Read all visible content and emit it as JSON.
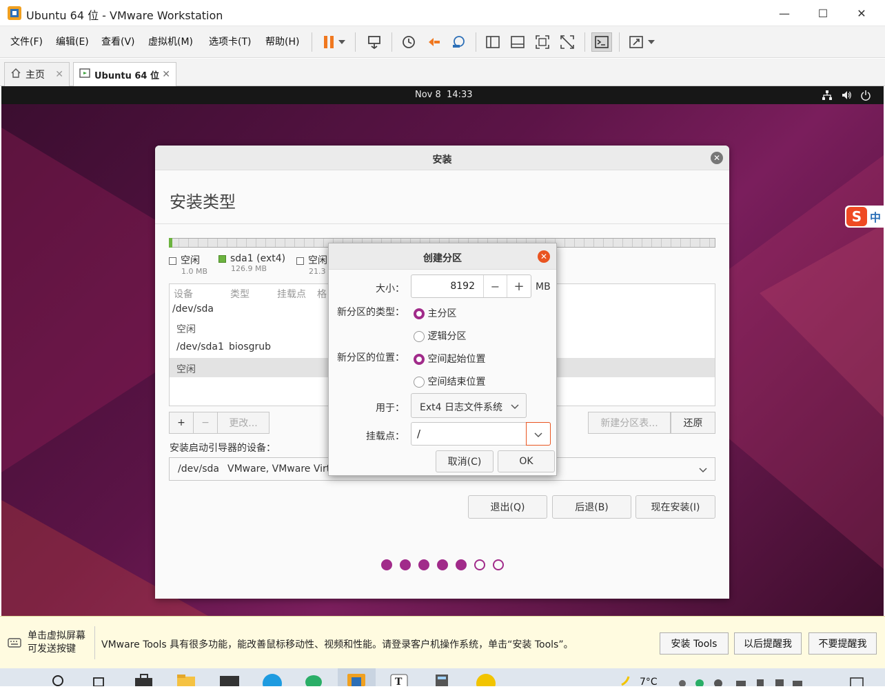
{
  "window": {
    "title": "Ubuntu 64 位 - VMware Workstation",
    "minimize": "—",
    "maximize": "☐",
    "close": "✕"
  },
  "menu": {
    "items": [
      "文件(F)",
      "编辑(E)",
      "查看(V)",
      "虚拟机(M)",
      "选项卡(T)",
      "帮助(H)"
    ]
  },
  "tabs": [
    {
      "label": "主页",
      "icon": "home-icon"
    },
    {
      "label": "Ubuntu 64 位",
      "icon": "vm-icon"
    }
  ],
  "ubuntu_topbar": {
    "date": "Nov 8",
    "time": "14:33"
  },
  "installer": {
    "window_title": "安装",
    "heading": "安装类型",
    "legend": [
      {
        "name": "空闲",
        "size": "1.0 MB",
        "color": "#ffffff"
      },
      {
        "name": "sda1 (ext4)",
        "size": "126.9 MB",
        "color": "#6cb33f"
      },
      {
        "name": "空闲",
        "size": "21.3",
        "color": "#ffffff"
      }
    ],
    "table_headers": [
      "设备",
      "类型",
      "挂载点",
      "格"
    ],
    "rows": [
      {
        "device": "/dev/sda",
        "type": ""
      },
      {
        "device": "空闲",
        "type": ""
      },
      {
        "device": "/dev/sda1",
        "type": "biosgrub"
      },
      {
        "device": "空闲",
        "type": ""
      }
    ],
    "add_btn": "+",
    "remove_btn": "−",
    "change_btn": "更改...",
    "new_table_btn": "新建分区表...",
    "revert_btn": "还原",
    "boot_label": "安装启动引导器的设备：",
    "boot_device": "/dev/sda",
    "boot_desc": "VMware, VMware Virt",
    "quit_btn": "退出(Q)",
    "back_btn": "后退(B)",
    "install_btn": "现在安装(I)",
    "progress_total": 7,
    "progress_done": 5
  },
  "dialog": {
    "title": "创建分区",
    "size_label": "大小：",
    "size_value": "8192",
    "size_unit": "MB",
    "minus": "−",
    "plus": "+",
    "type_label": "新分区的类型：",
    "type_primary": "主分区",
    "type_logical": "逻辑分区",
    "location_label": "新分区的位置：",
    "loc_start": "空间起始位置",
    "loc_end": "空间结束位置",
    "use_label": "用于：",
    "use_value": "Ext4 日志文件系统",
    "mount_label": "挂载点：",
    "mount_value": "/",
    "cancel": "取消(C)",
    "ok": "OK"
  },
  "notice": {
    "hint_line1": "单击虚拟屏幕",
    "hint_line2": "可发送按键",
    "message": "VMware Tools 具有很多功能，能改善鼠标移动性、视频和性能。请登录客户机操作系统，单击“安装 Tools”。",
    "install_tools": "安装 Tools",
    "remind_later": "以后提醒我",
    "never_remind": "不要提醒我"
  },
  "taskbar": {
    "temperature": "7°C"
  },
  "ime": {
    "label": "中"
  }
}
